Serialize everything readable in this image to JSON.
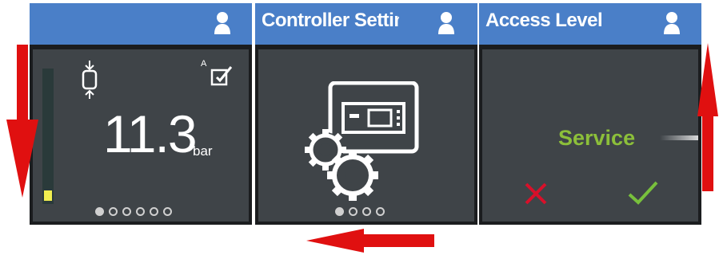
{
  "screens": [
    {
      "header": {
        "title": "",
        "user_icon": "user-icon"
      },
      "value": "11.3",
      "unit": "bar",
      "mode_letter": "A",
      "icons": [
        "compress-icon",
        "edit-checkbox-icon"
      ],
      "level_fraction": 0.08,
      "pagination": {
        "total": 6,
        "active": 1
      }
    },
    {
      "header": {
        "title": "Controller Setting",
        "user_icon": "user-icon"
      },
      "icons": [
        "controller-settings-icon"
      ],
      "pagination": {
        "total": 4,
        "active": 1
      }
    },
    {
      "header": {
        "title": "Access Level",
        "user_icon": "user-icon"
      },
      "selected_value": "Service",
      "icons": [
        "cancel-icon",
        "confirm-icon"
      ]
    }
  ],
  "arrows": [
    "down",
    "left",
    "up"
  ],
  "colors": {
    "header": "#4a7fc8",
    "panel": "#3f4448",
    "frame": "#1b1d1f",
    "arrow": "#e01010",
    "service": "#8cbf3a",
    "cancel": "#d8102a",
    "confirm": "#78c03c",
    "level": "#f2ee50"
  }
}
